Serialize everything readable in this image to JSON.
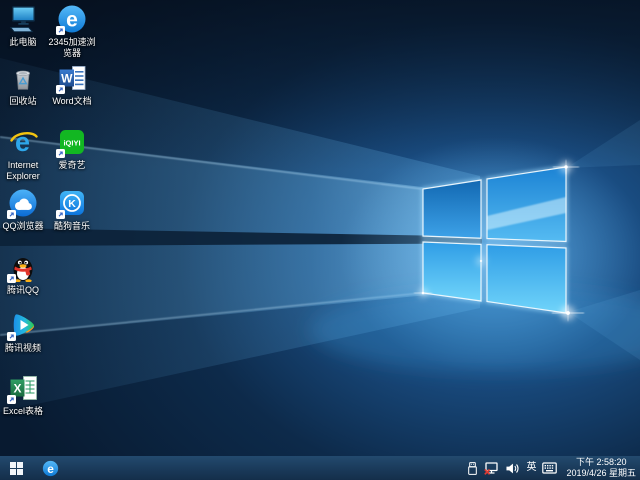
{
  "desktop": {
    "icons": [
      {
        "name": "this-pc",
        "label": "此电脑",
        "shortcut": false
      },
      {
        "name": "2345-browser",
        "label": "2345加速浏\n览器",
        "shortcut": true,
        "glyph": "e"
      },
      {
        "name": "recycle-bin",
        "label": "回收站",
        "shortcut": false
      },
      {
        "name": "word-document",
        "label": "Word文档",
        "shortcut": true,
        "glyph": "W"
      },
      {
        "name": "internet-explorer",
        "label": "Internet\nExplorer",
        "shortcut": false,
        "glyph": "e"
      },
      {
        "name": "iqiyi",
        "label": "爱奇艺",
        "shortcut": true,
        "glyph": "iQIYI"
      },
      {
        "name": "qq-browser",
        "label": "QQ浏览器",
        "shortcut": true
      },
      {
        "name": "kugou-music",
        "label": "酷狗音乐",
        "shortcut": true,
        "glyph": "K"
      },
      {
        "name": "tencent-qq",
        "label": "腾讯QQ",
        "shortcut": true
      },
      {
        "name": "tencent-video",
        "label": "腾讯视频",
        "shortcut": true
      },
      {
        "name": "excel-sheet",
        "label": "Excel表格",
        "shortcut": true,
        "glyph": "X"
      }
    ]
  },
  "taskbar": {
    "pinned_glyph": "e",
    "ime_indicator": "英",
    "clock": {
      "time": "下午 2:58:20",
      "date": "2019/4/26 星期五"
    }
  },
  "colors": {
    "taskbar": "#1a3a5c",
    "wallpaper_base": "#0a1e36",
    "logo_blue": "#2f9ce2"
  }
}
